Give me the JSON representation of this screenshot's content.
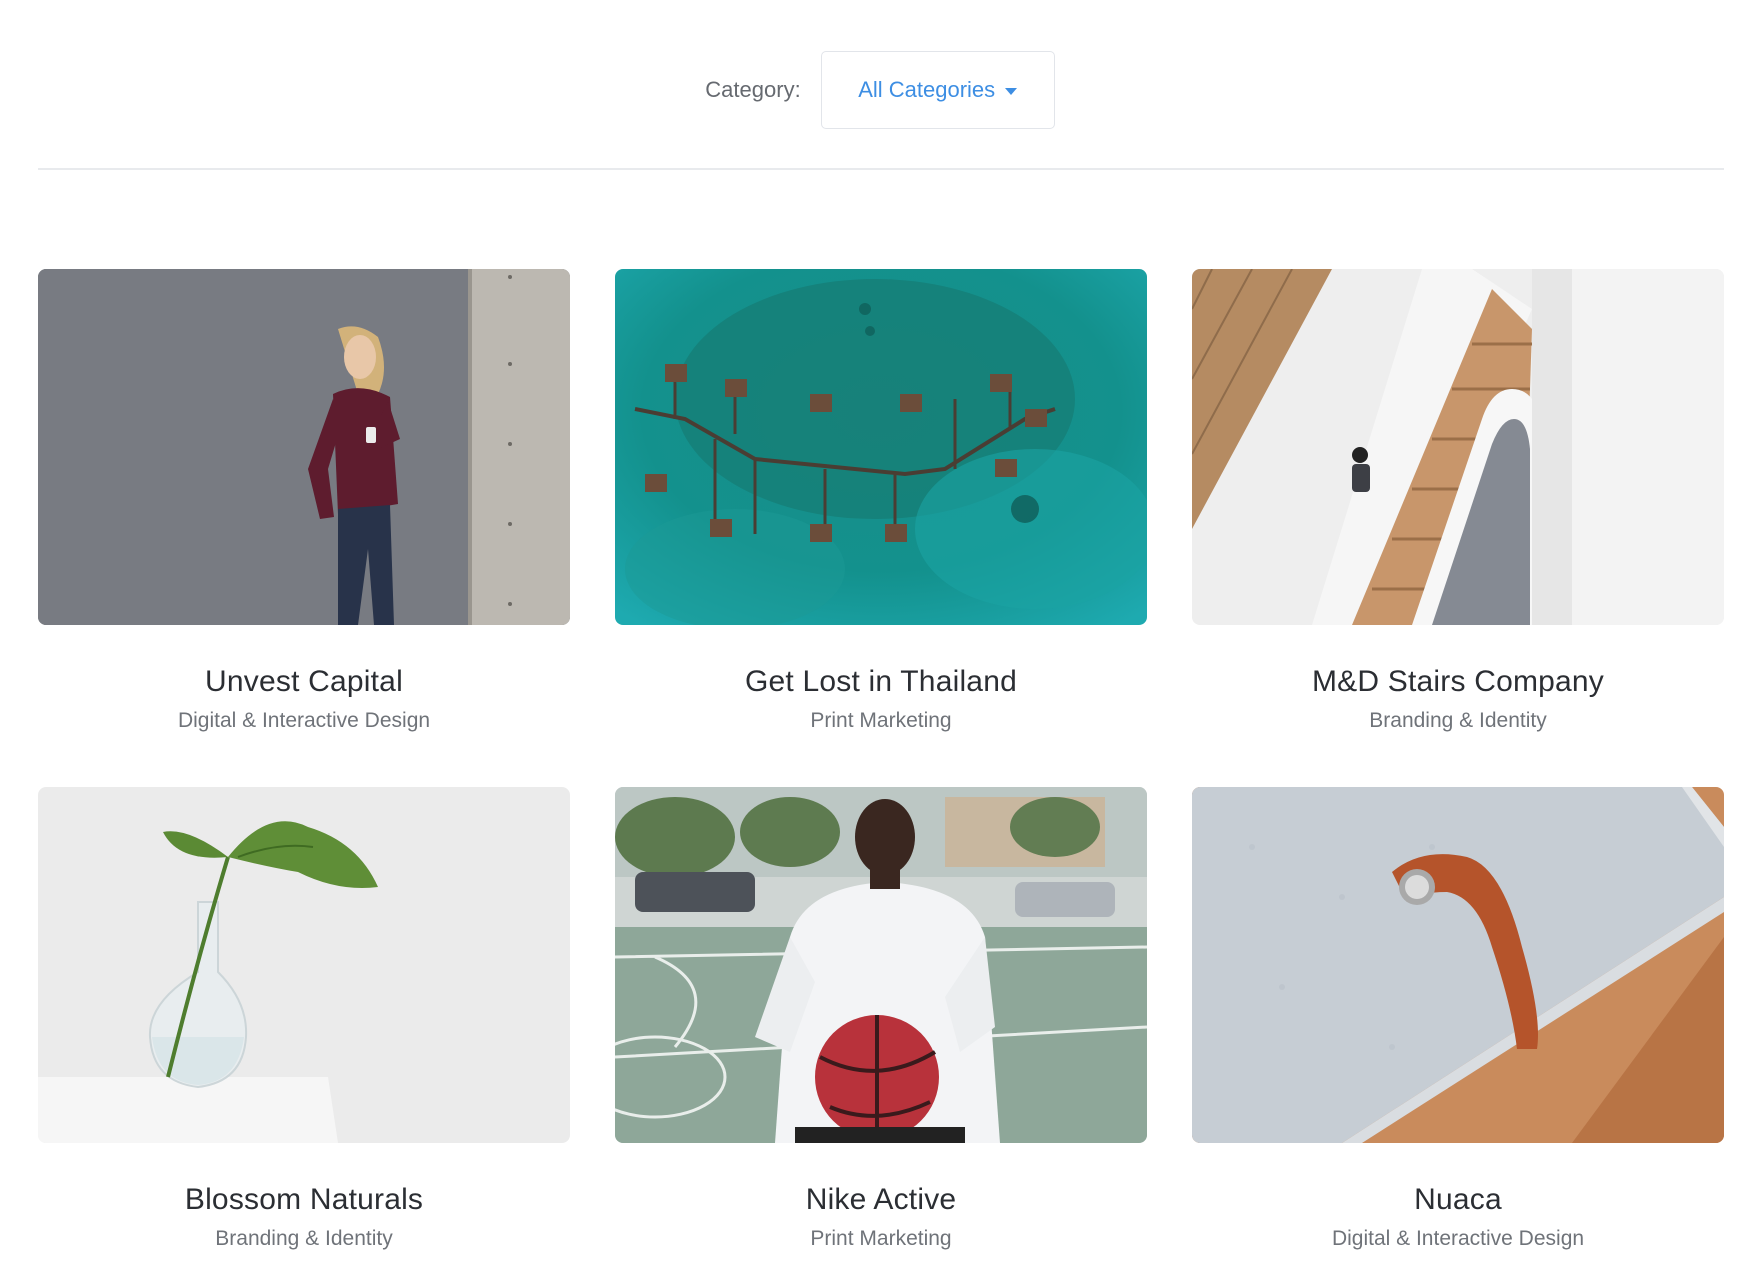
{
  "filter": {
    "label": "Category:",
    "selected": "All Categories",
    "accent": "#3d8ee3"
  },
  "projects": [
    {
      "title": "Unvest Capital",
      "category": "Digital & Interactive Design",
      "image": "woman-with-phone-photo"
    },
    {
      "title": "Get Lost in Thailand",
      "category": "Print Marketing",
      "image": "overwater-bungalows-photo"
    },
    {
      "title": "M&D Stairs Company",
      "category": "Branding & Identity",
      "image": "spiral-staircase-photo"
    },
    {
      "title": "Blossom Naturals",
      "category": "Branding & Identity",
      "image": "plant-vase-photo"
    },
    {
      "title": "Nike Active",
      "category": "Print Marketing",
      "image": "basketball-player-photo"
    },
    {
      "title": "Nuaca",
      "category": "Digital & Interactive Design",
      "image": "laptop-sleeve-photo"
    }
  ]
}
